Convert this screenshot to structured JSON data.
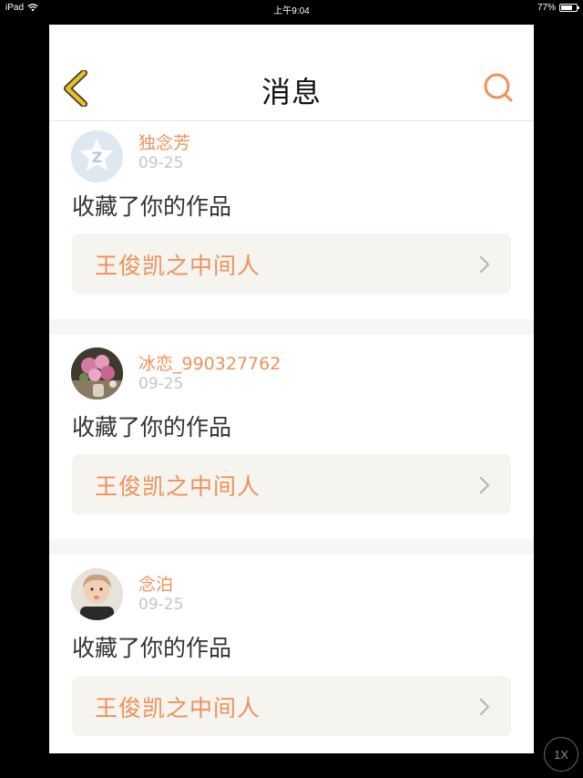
{
  "status_bar": {
    "device": "iPad",
    "time": "上午9:04",
    "battery_text": "77%",
    "battery_level": 0.77
  },
  "nav": {
    "title": "消息",
    "back_icon": "chevron-left-icon",
    "search_icon": "search-icon",
    "accent_back": "#e8c21a",
    "accent_search": "#f0915a"
  },
  "messages": [
    {
      "username": "独念芳",
      "date": "09-25",
      "action": "收藏了你的作品",
      "work_title": "王俊凯之中间人",
      "avatar": "qq-default-avatar"
    },
    {
      "username": "冰恋_990327762",
      "date": "09-25",
      "action": "收藏了你的作品",
      "work_title": "王俊凯之中间人",
      "avatar": "flowers-avatar"
    },
    {
      "username": "念泊",
      "date": "09-25",
      "action": "收藏了你的作品",
      "work_title": "王俊凯之中间人",
      "avatar": "child-photo-avatar"
    }
  ],
  "speed_badge": "1X",
  "colors": {
    "username": "#f0915a",
    "work_title": "#f0915a",
    "work_bg": "#f5f4ef",
    "date": "#c6c6c6"
  }
}
